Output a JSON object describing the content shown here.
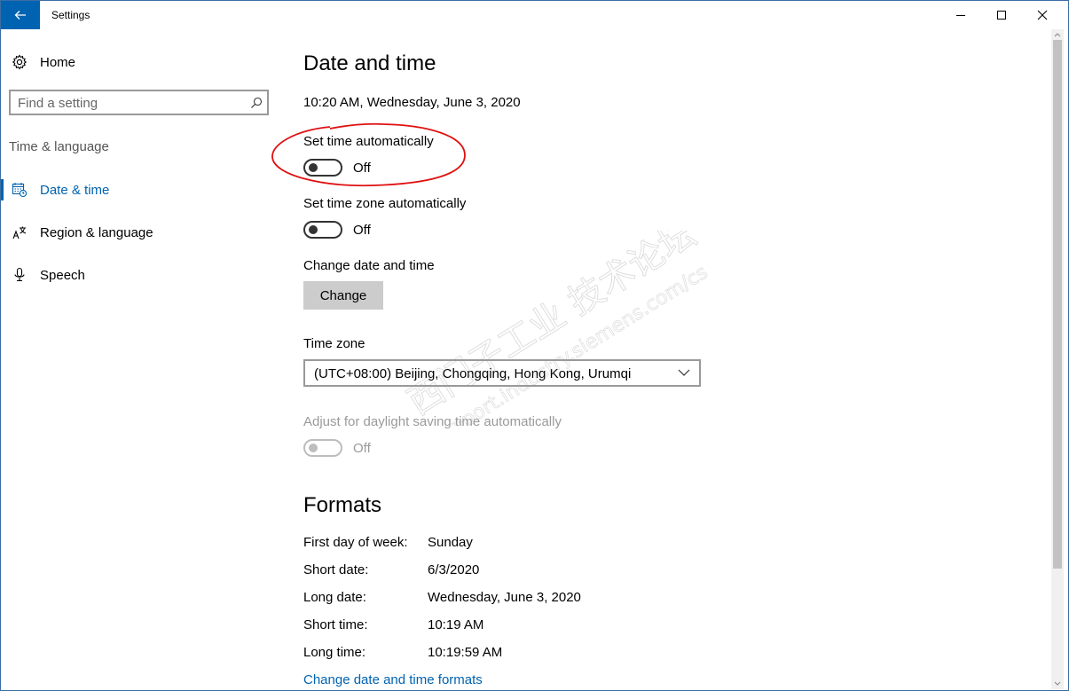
{
  "window": {
    "title": "Settings",
    "accent_color": "#0063b1",
    "controls": [
      "minimize-icon",
      "maximize-icon",
      "close-icon"
    ]
  },
  "sidebar": {
    "home_label": "Home",
    "search_placeholder": "Find a setting",
    "section_label": "Time & language",
    "items": [
      {
        "label": "Date & time",
        "icon": "calendar-clock-icon",
        "active": true
      },
      {
        "label": "Region & language",
        "icon": "language-icon",
        "active": false
      },
      {
        "label": "Speech",
        "icon": "microphone-icon",
        "active": false
      }
    ]
  },
  "main": {
    "title": "Date and time",
    "current_datetime": "10:20 AM, Wednesday, June 3, 2020",
    "set_time_auto": {
      "label": "Set time automatically",
      "state": "Off"
    },
    "set_timezone_auto": {
      "label": "Set time zone automatically",
      "state": "Off"
    },
    "change_date_time": {
      "label": "Change date and time",
      "button": "Change"
    },
    "time_zone": {
      "label": "Time zone",
      "value": "(UTC+08:00) Beijing, Chongqing, Hong Kong, Urumqi"
    },
    "daylight": {
      "label": "Adjust for daylight saving time automatically",
      "state": "Off",
      "disabled": true
    },
    "formats": {
      "title": "Formats",
      "rows": [
        {
          "label": "First day of week:",
          "value": "Sunday"
        },
        {
          "label": "Short date:",
          "value": "6/3/2020"
        },
        {
          "label": "Long date:",
          "value": "Wednesday, June 3, 2020"
        },
        {
          "label": "Short time:",
          "value": "10:19 AM"
        },
        {
          "label": "Long time:",
          "value": "10:19:59 AM"
        }
      ],
      "link": "Change date and time formats"
    }
  },
  "watermark": {
    "line1": "西门子工业 技术论坛",
    "line2": "support.industry.siemens.com/cs"
  }
}
